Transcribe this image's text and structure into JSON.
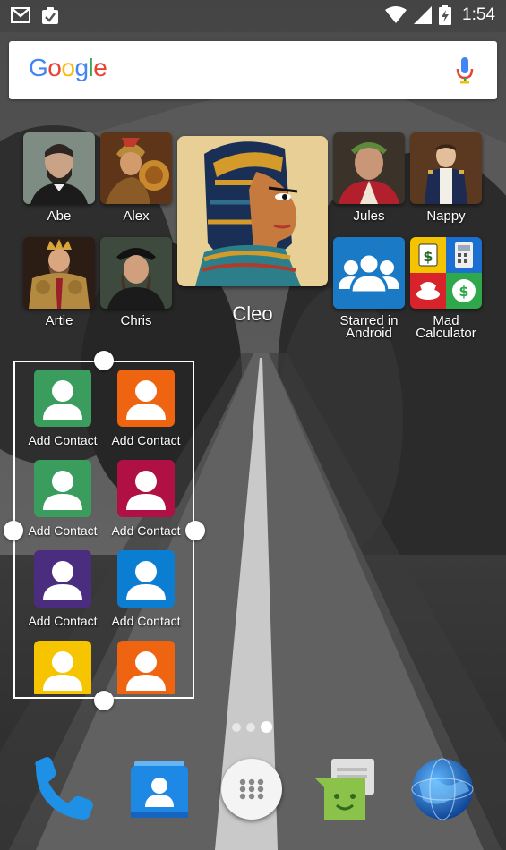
{
  "status_bar": {
    "time": "1:54",
    "left_icons": [
      "gmail-icon",
      "clipboard-check-icon"
    ],
    "right_icons": [
      "wifi-icon",
      "cell-signal-icon",
      "battery-charging-icon"
    ]
  },
  "search": {
    "logo_letters": [
      "G",
      "o",
      "o",
      "g",
      "l",
      "e"
    ],
    "logo_colors": [
      "#4285F4",
      "#EA4335",
      "#FBBC05",
      "#4285F4",
      "#34A853",
      "#EA4335"
    ]
  },
  "apps": {
    "abe": "Abe",
    "alex": "Alex",
    "cleo": "Cleo",
    "jules": "Jules",
    "nappy": "Nappy",
    "artie": "Artie",
    "chris": "Chris",
    "starred": "Starred in Android",
    "calculator": "Mad Calculator"
  },
  "widget": {
    "contacts": [
      {
        "label": "Add Contact",
        "color": "#3a9d5d"
      },
      {
        "label": "Add Contact",
        "color": "#ee6411"
      },
      {
        "label": "Add Contact",
        "color": "#3a9d5d"
      },
      {
        "label": "Add Contact",
        "color": "#b01043"
      },
      {
        "label": "Add Contact",
        "color": "#4b2d7f"
      },
      {
        "label": "Add Contact",
        "color": "#0b7ed1"
      },
      {
        "label": "",
        "color": "#f7c400"
      },
      {
        "label": "",
        "color": "#ee6411"
      }
    ]
  },
  "pager": {
    "pages": 3,
    "current": 3
  },
  "dock": [
    "phone-icon",
    "contacts-icon",
    "all-apps-icon",
    "messenger-icon",
    "browser-globe-icon"
  ]
}
